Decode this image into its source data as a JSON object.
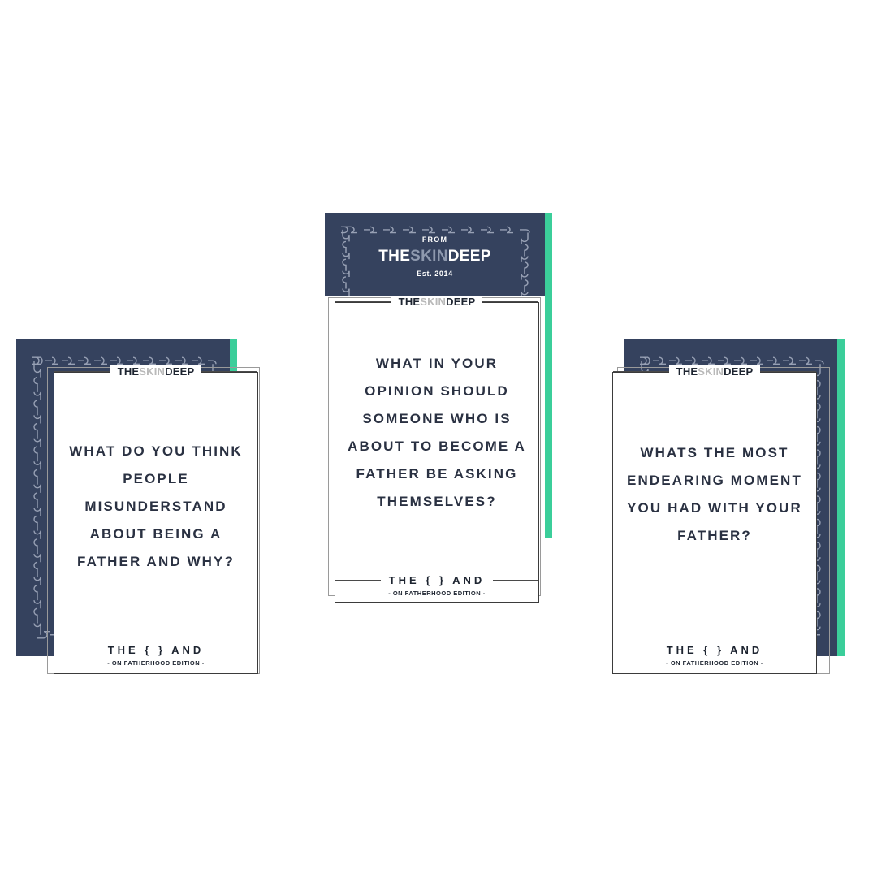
{
  "brand": {
    "from_label": "FROM",
    "logo_pre": "THE",
    "logo_mid": "SKIN",
    "logo_post": "DEEP",
    "established": "Est. 2014",
    "navy_color": "#35425E",
    "teal_color": "#3BCE9A",
    "text_color": "#2A3142",
    "logo_mid_color": "#B9B9B9"
  },
  "footer": {
    "the_and": "THE {    } AND",
    "edition": "- ON FATHERHOOD EDITION -"
  },
  "header": {
    "logo_pre": "THE",
    "logo_mid": "SKIN",
    "logo_post": "DEEP"
  },
  "stacks": [
    {
      "id": "left",
      "partial_letter": "Q",
      "question": "WHAT DO YOU THINK PEOPLE MISUNDERSTAND ABOUT BEING A FATHER AND WHY?"
    },
    {
      "id": "center",
      "partial_letter": "",
      "question": "WHAT IN YOUR OPINION SHOULD SOMEONE WHO IS ABOUT TO BECOME A FATHER BE ASKING THEMSELVES?"
    },
    {
      "id": "right",
      "partial_letter": "",
      "question": "WHATS THE MOST ENDEARING MOMENT YOU HAD WITH YOUR FATHER?"
    }
  ]
}
